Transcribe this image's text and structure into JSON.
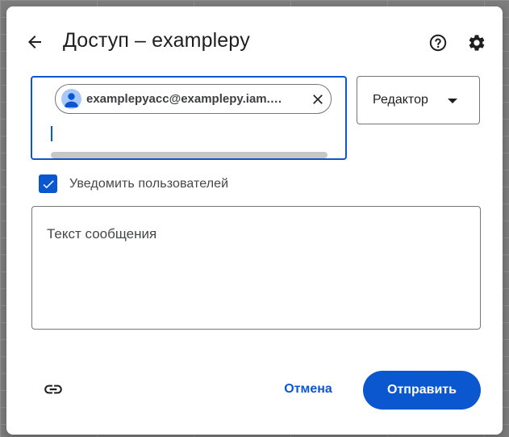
{
  "dialog": {
    "title": "Доступ – examplepy"
  },
  "recipients": {
    "chip_label": "examplepyacc@examplepy.iam.…"
  },
  "role": {
    "selected": "Редактор"
  },
  "notify": {
    "label": "Уведомить пользователей",
    "checked": true
  },
  "message": {
    "placeholder": "Текст сообщения"
  },
  "actions": {
    "cancel_label": "Отмена",
    "send_label": "Отправить"
  },
  "icons": {
    "back": "arrow-back-icon",
    "help": "help-circle-icon",
    "settings": "gear-icon",
    "avatar": "person-avatar-icon",
    "remove": "close-icon",
    "dropdown": "caret-down-icon",
    "checkbox": "check-icon",
    "link": "link-icon"
  },
  "colors": {
    "accent": "#0b57d0",
    "chip_avatar": "#a8c7fa",
    "text_primary": "#1f1f1f",
    "text_secondary": "#444746"
  }
}
